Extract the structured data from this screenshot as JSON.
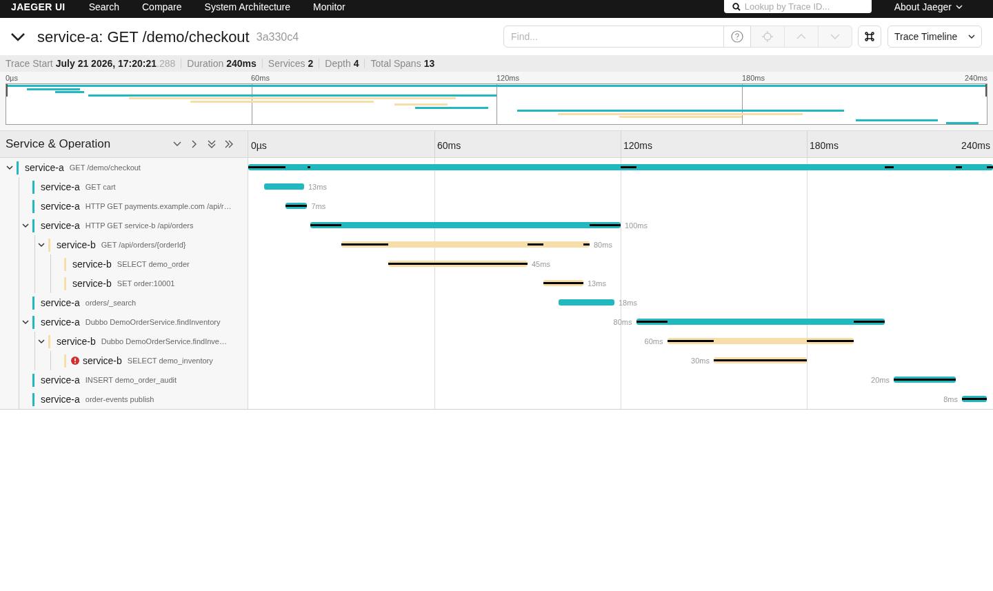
{
  "nav": {
    "brand": "JAEGER UI",
    "links": [
      "Search",
      "Compare",
      "System Architecture",
      "Monitor"
    ],
    "lookup": {
      "placeholder": "Lookup by Trace ID..."
    },
    "about": "About Jaeger"
  },
  "trace": {
    "expanded": true,
    "title": "service-a: GET /demo/checkout",
    "trace_id": "3a330c4",
    "find": {
      "placeholder": "Find..."
    },
    "view": "Trace Timeline"
  },
  "stats": [
    {
      "label": "Trace Start",
      "value": "July 21 2026, 17:20:21",
      "fraction": ".288"
    },
    {
      "label": "Duration",
      "value": "240ms"
    },
    {
      "label": "Services",
      "value": "2"
    },
    {
      "label": "Depth",
      "value": "4"
    },
    {
      "label": "Total Spans",
      "value": "13"
    }
  ],
  "minimap": {
    "ticks": [
      "0µs",
      "60ms",
      "120ms",
      "180ms",
      "240ms"
    ]
  },
  "timeline": {
    "column_title": "Service & Operation",
    "ticks": [
      "0µs",
      "60ms",
      "120ms",
      "180ms",
      "240ms"
    ]
  },
  "spans": [
    {
      "service": "service-a",
      "operation": "GET /demo/checkout",
      "color": "#22b8c0",
      "error": false,
      "expanded": true,
      "children": [
        {
          "service": "service-a",
          "operation": "GET cart",
          "color": "#22b8c0",
          "duration_label": "13ms",
          "error": false
        },
        {
          "service": "service-a",
          "operation": "HTTP GET payments.example.com /api/r…",
          "color": "#22b8c0",
          "duration_label": "7ms",
          "error": false
        },
        {
          "service": "service-a",
          "operation": "HTTP GET service-b /api/orders",
          "color": "#22b8c0",
          "duration_label": "100ms",
          "error": false,
          "expanded": true,
          "children": [
            {
              "service": "service-b",
              "operation": "GET /api/orders/{orderId}",
              "color": "#f7dea9",
              "duration_label": "80ms",
              "error": false,
              "expanded": true,
              "children": [
                {
                  "service": "service-b",
                  "operation": "SELECT demo_order",
                  "color": "#f7dea9",
                  "duration_label": "45ms",
                  "error": false
                },
                {
                  "service": "service-b",
                  "operation": "SET order:10001",
                  "color": "#f7dea9",
                  "duration_label": "13ms",
                  "error": false
                }
              ]
            }
          ]
        },
        {
          "service": "service-a",
          "operation": "orders/_search",
          "color": "#22b8c0",
          "duration_label": "18ms",
          "error": false
        },
        {
          "service": "service-a",
          "operation": "Dubbo DemoOrderService.findInventory",
          "color": "#22b8c0",
          "duration_label": "80ms",
          "error": false,
          "expanded": true,
          "children": [
            {
              "service": "service-b",
              "operation": "Dubbo DemoOrderService.findInve…",
              "color": "#f7dea9",
              "duration_label": "60ms",
              "error": false,
              "expanded": true,
              "children": [
                {
                  "service": "service-b",
                  "operation": "SELECT demo_inventory",
                  "color": "#f7dea9",
                  "duration_label": "30ms",
                  "error": true
                }
              ]
            }
          ]
        },
        {
          "service": "service-a",
          "operation": "INSERT demo_order_audit",
          "color": "#22b8c0",
          "duration_label": "20ms",
          "error": false
        },
        {
          "service": "service-a",
          "operation": "order-events publish",
          "color": "#22b8c0",
          "duration_label": "8ms",
          "error": false
        }
      ]
    }
  ]
}
